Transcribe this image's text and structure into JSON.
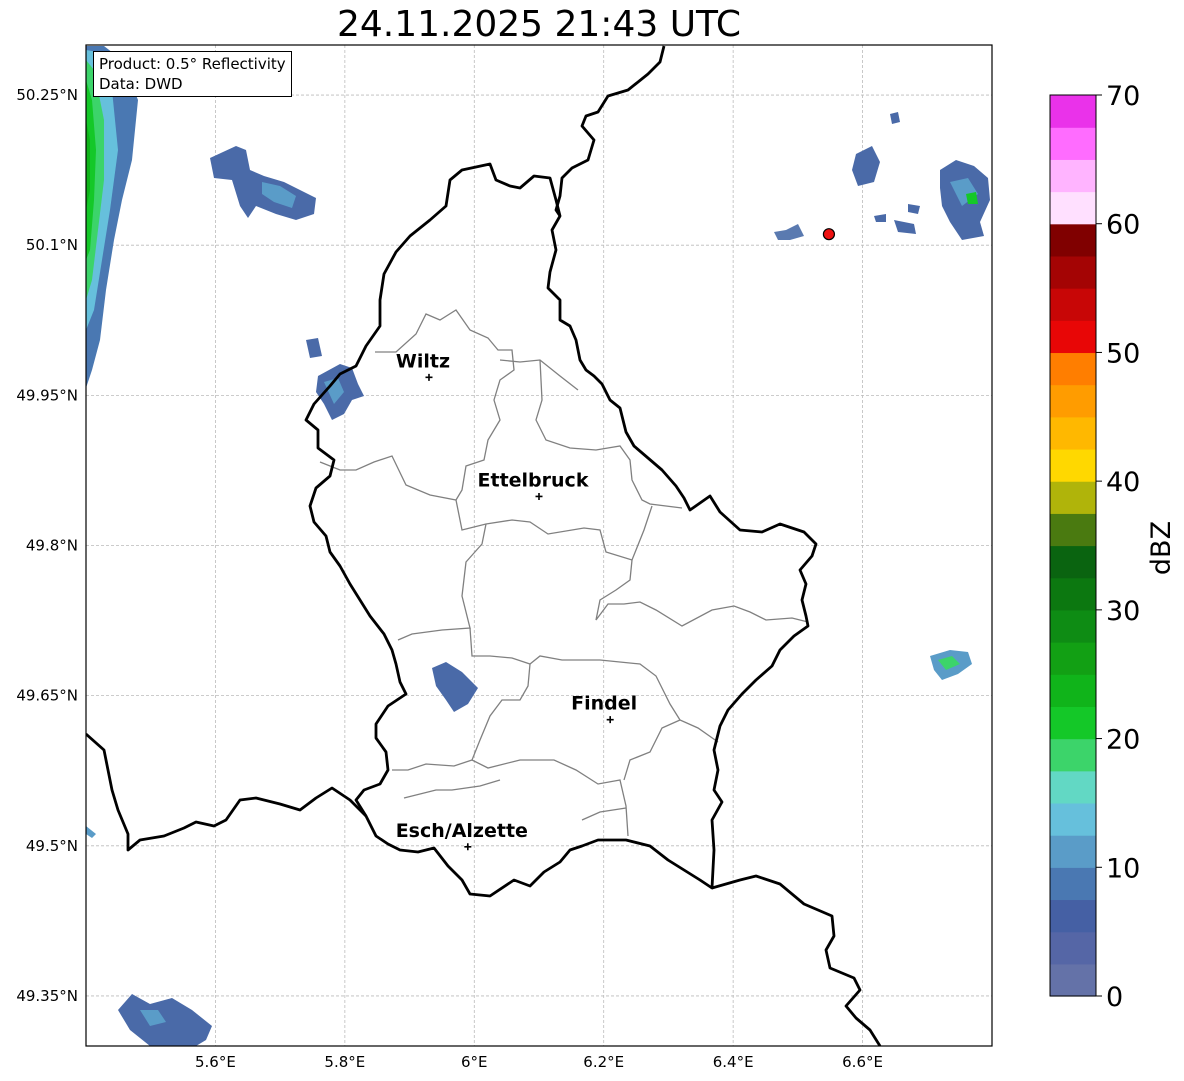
{
  "title": "24.11.2025 21:43 UTC",
  "info": {
    "product": "Product: 0.5° Reflectivity",
    "data": "Data: DWD"
  },
  "map": {
    "lon_range": [
      5.4,
      6.8
    ],
    "lat_range": [
      49.3,
      50.3
    ],
    "x_ticks": [
      {
        "value": 5.6,
        "label": "5.6°E"
      },
      {
        "value": 5.8,
        "label": "5.8°E"
      },
      {
        "value": 6.0,
        "label": "6°E"
      },
      {
        "value": 6.2,
        "label": "6.2°E"
      },
      {
        "value": 6.4,
        "label": "6.4°E"
      },
      {
        "value": 6.6,
        "label": "6.6°E"
      }
    ],
    "y_ticks": [
      {
        "value": 50.25,
        "label": "50.25°N"
      },
      {
        "value": 50.1,
        "label": "50.1°N"
      },
      {
        "value": 49.95,
        "label": "49.95°N"
      },
      {
        "value": 49.8,
        "label": "49.8°N"
      },
      {
        "value": 49.65,
        "label": "49.65°N"
      },
      {
        "value": 49.5,
        "label": "49.5°N"
      },
      {
        "value": 49.35,
        "label": "49.35°N"
      }
    ],
    "grid": true,
    "cities": [
      {
        "name": "Wiltz",
        "lon": 5.93,
        "lat": 49.968
      },
      {
        "name": "Ettelbruck",
        "lon": 6.1,
        "lat": 49.849
      },
      {
        "name": "Findel",
        "lon": 6.21,
        "lat": 49.626
      },
      {
        "name": "Esch/Alzette",
        "lon": 5.99,
        "lat": 49.499
      }
    ],
    "radar_site": {
      "lon": 6.548,
      "lat": 50.111,
      "color": "#ee1111"
    }
  },
  "colorbar": {
    "label": "dBZ",
    "min": 0,
    "max": 70,
    "ticks": [
      0,
      10,
      20,
      30,
      40,
      50,
      60,
      70
    ],
    "colors": [
      "#6472a8",
      "#5566a6",
      "#4560a4",
      "#4a78b2",
      "#5a9cc8",
      "#66c0dc",
      "#62d8c4",
      "#3cd46a",
      "#14c828",
      "#10b41a",
      "#12a014",
      "#0e8c14",
      "#0c7810",
      "#0a6410",
      "#4a7a10",
      "#b0b40a",
      "#ffd800",
      "#ffb800",
      "#ff9c00",
      "#ff7e00",
      "#e80606",
      "#c80606",
      "#a40404",
      "#800000",
      "#ffe0ff",
      "#ffb4ff",
      "#ff6cff",
      "#ea32ea"
    ]
  }
}
